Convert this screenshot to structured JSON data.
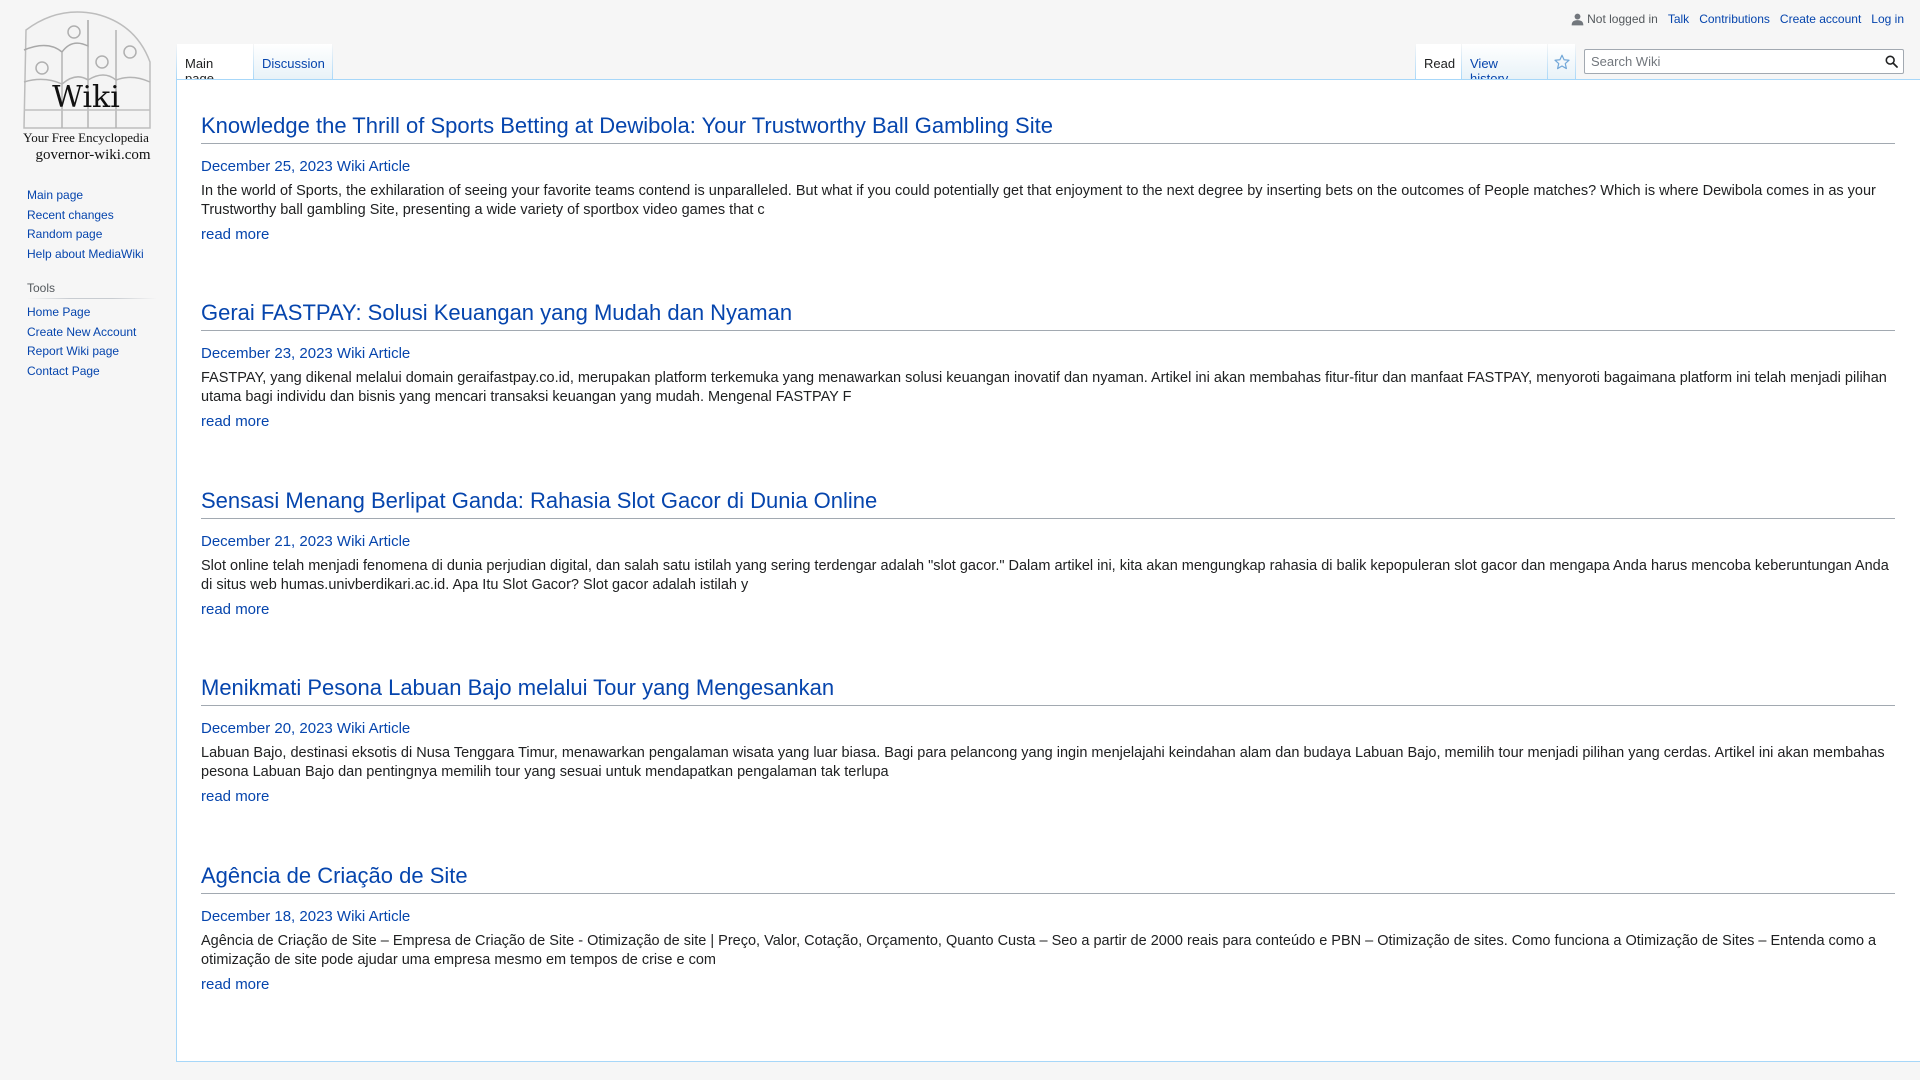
{
  "logo": {
    "word": "Wiki",
    "tagline": "Your Free Encyclopedia",
    "domain": "governor-wiki.com"
  },
  "personal_tools": {
    "not_logged_in": "Not logged in",
    "talk": "Talk",
    "contributions": "Contributions",
    "create_account": "Create account",
    "log_in": "Log in"
  },
  "tabs": {
    "main_page": "Main page",
    "discussion": "Discussion",
    "read": "Read",
    "view_history": "View history"
  },
  "search": {
    "placeholder": "Search Wiki"
  },
  "sidebar": {
    "navigation": [
      "Main page",
      "Recent changes",
      "Random page",
      "Help about MediaWiki"
    ],
    "tools_heading": "Tools",
    "tools": [
      "Home Page",
      "Create New Account",
      "Report Wiki page",
      "Contact Page"
    ]
  },
  "articles": [
    {
      "title": "Knowledge the Thrill of Sports Betting at Dewibola: Your Trustworthy Ball Gambling Site",
      "date": "December 25, 2023 Wiki Article",
      "excerpt": "In the world of Sports, the exhilaration of seeing your favorite teams contend is unparalleled. But what if you could potentially get that enjoyment to the next degree by inserting bets on the outcomes of People matches? Which is where Dewibola comes in as your Trustworthy ball gambling Site, presenting a wide variety of sportbox video games that c",
      "read_more": "read more"
    },
    {
      "title": "Gerai FASTPAY: Solusi Keuangan yang Mudah dan Nyaman",
      "date": "December 23, 2023 Wiki Article",
      "excerpt": "FASTPAY, yang dikenal melalui domain geraifastpay.co.id, merupakan platform terkemuka yang menawarkan solusi keuangan inovatif dan nyaman. Artikel ini akan membahas fitur-fitur dan manfaat FASTPAY, menyoroti bagaimana platform ini telah menjadi pilihan utama bagi individu dan bisnis yang mencari transaksi keuangan yang mudah. Mengenal FASTPAY F",
      "read_more": "read more"
    },
    {
      "title": "Sensasi Menang Berlipat Ganda: Rahasia Slot Gacor di Dunia Online",
      "date": "December 21, 2023 Wiki Article",
      "excerpt": "Slot online telah menjadi fenomena di dunia perjudian digital, dan salah satu istilah yang sering terdengar adalah \"slot gacor.\" Dalam artikel ini, kita akan mengungkap rahasia di balik kepopuleran slot gacor dan mengapa Anda harus mencoba keberuntungan Anda di situs web humas.univberdikari.ac.id. Apa Itu Slot Gacor? Slot gacor adalah istilah y",
      "read_more": "read more"
    },
    {
      "title": "Menikmati Pesona Labuan Bajo melalui Tour yang Mengesankan",
      "date": "December 20, 2023 Wiki Article",
      "excerpt": "Labuan Bajo, destinasi eksotis di Nusa Tenggara Timur, menawarkan pengalaman wisata yang luar biasa. Bagi para pelancong yang ingin menjelajahi keindahan alam dan budaya Labuan Bajo, memilih tour menjadi pilihan yang cerdas. Artikel ini akan membahas pesona Labuan Bajo dan pentingnya memilih tour yang sesuai untuk mendapatkan pengalaman tak terlupa",
      "read_more": "read more"
    },
    {
      "title": "Agência de Criação de Site",
      "date": "December 18, 2023 Wiki Article",
      "excerpt": "Agência de Criação de Site – Empresa de Criação de Site - Otimização de site | Preço, Valor, Cotação, Orçamento, Quanto Custa – Seo a partir de 2000 reais para conteúdo e PBN – Otimização de sites. Como funciona a Otimização de Sites – Entenda como a otimização de site pode ajudar uma empresa mesmo em tempos de crise e com",
      "read_more": "read more"
    }
  ]
}
